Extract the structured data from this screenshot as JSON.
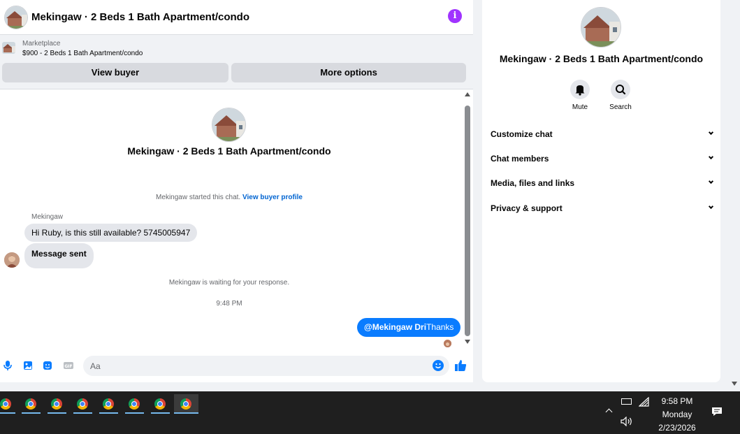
{
  "chat": {
    "title": "Mekingaw · 2 Beds 1 Bath Apartment/condo",
    "marketplace_label": "Marketplace",
    "listing_price_line": "$900 - 2 Beds 1 Bath Apartment/condo",
    "view_buyer_label": "View buyer",
    "more_options_label": "More options",
    "listing_title": "Mekingaw · 2 Beds 1 Bath Apartment/condo",
    "started_text": "Mekingaw started this chat.",
    "view_buyer_profile_label": "View buyer profile",
    "sender_name": "Mekingaw",
    "incoming_message": "Hi Ruby, is this still available? 5745005947",
    "message_sent_label": "Message sent",
    "waiting_text": "Mekingaw is waiting for your response.",
    "timestamp": "9:48 PM",
    "outgoing_mention": "@Mekingaw Dri",
    "outgoing_text": "Thanks",
    "composer_placeholder": "Aa"
  },
  "details": {
    "title": "Mekingaw · 2 Beds 1 Bath Apartment/condo",
    "actions": [
      {
        "label": "Mute",
        "icon": "bell-icon"
      },
      {
        "label": "Search",
        "icon": "search-icon"
      }
    ],
    "sections": [
      {
        "label": "Customize chat"
      },
      {
        "label": "Chat members"
      },
      {
        "label": "Media, files and links"
      },
      {
        "label": "Privacy & support"
      }
    ]
  },
  "taskbar": {
    "apps": [
      "chrome-icon",
      "chrome-icon",
      "chrome-icon",
      "chrome-icon",
      "chrome-icon",
      "chrome-icon",
      "chrome-icon",
      "chrome-icon"
    ],
    "clock_time": "9:58 PM",
    "clock_day": "Monday",
    "clock_date": "2/23/2026"
  },
  "colors": {
    "accent": "#0a7cff",
    "info_purple": "#a033ff",
    "link": "#0064d1",
    "taskbar": "#1f1f1f"
  }
}
